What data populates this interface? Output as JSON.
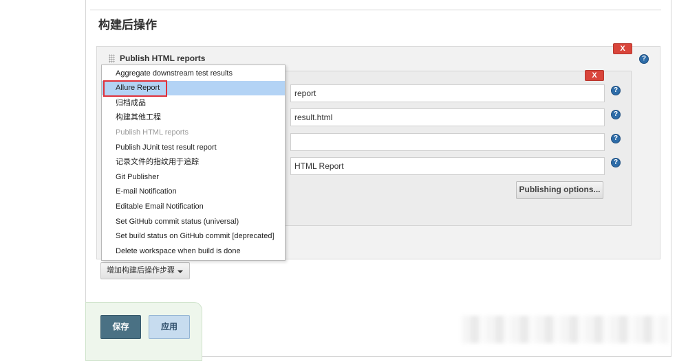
{
  "section": {
    "title": "构建后操作"
  },
  "panel": {
    "title": "Publish HTML reports",
    "delete_label": "X",
    "help_label": "?"
  },
  "report": {
    "delete_label": "X",
    "fields": [
      {
        "value": "report"
      },
      {
        "value": "result.html"
      },
      {
        "value": ""
      },
      {
        "value": "HTML Report"
      }
    ],
    "help_label": "?",
    "publishing_options": "Publishing options..."
  },
  "menu": {
    "items": [
      {
        "label": "Aggregate downstream test results",
        "state": "normal"
      },
      {
        "label": "Allure Report",
        "state": "selected"
      },
      {
        "label": "归档成品",
        "state": "normal"
      },
      {
        "label": "构建其他工程",
        "state": "normal"
      },
      {
        "label": "Publish HTML reports",
        "state": "disabled"
      },
      {
        "label": "Publish JUnit test result report",
        "state": "normal"
      },
      {
        "label": "记录文件的指纹用于追踪",
        "state": "normal"
      },
      {
        "label": "Git Publisher",
        "state": "normal"
      },
      {
        "label": "E-mail Notification",
        "state": "normal"
      },
      {
        "label": "Editable Email Notification",
        "state": "normal"
      },
      {
        "label": "Set GitHub commit status (universal)",
        "state": "normal"
      },
      {
        "label": "Set build status on GitHub commit [deprecated]",
        "state": "normal"
      },
      {
        "label": "Delete workspace when build is done",
        "state": "normal"
      }
    ]
  },
  "add_step": {
    "label": "增加构建后操作步骤"
  },
  "footer": {
    "save_label": "保存",
    "apply_label": "应用"
  },
  "colors": {
    "selected_bg": "#b3d3f5",
    "delete_red": "#d9453b",
    "save_bg": "#4a7184",
    "apply_bg": "#c7dcef",
    "highlight_border": "#e0303a"
  }
}
